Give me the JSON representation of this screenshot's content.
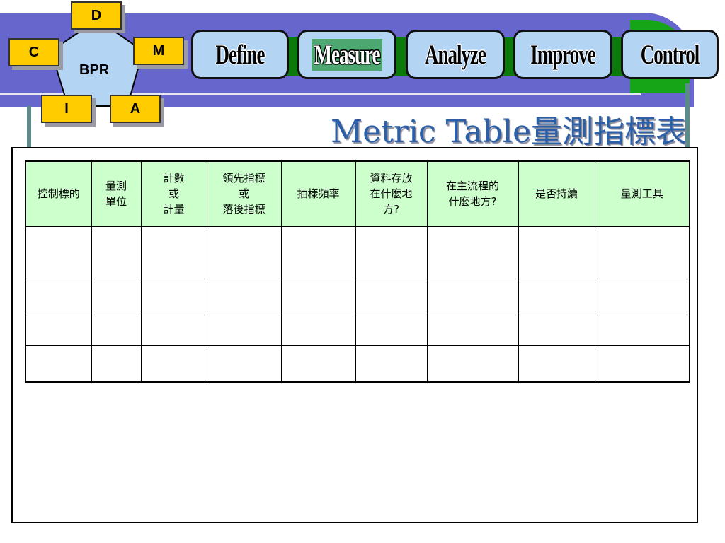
{
  "bpr": {
    "center_label": "BPR",
    "nodes": [
      "D",
      "M",
      "A",
      "I",
      "C"
    ]
  },
  "phases": [
    {
      "label": "Define",
      "active": false
    },
    {
      "label": "Measure",
      "active": true
    },
    {
      "label": "Analyze",
      "active": false
    },
    {
      "label": "Improve",
      "active": false
    },
    {
      "label": "Control",
      "active": false
    }
  ],
  "title": "Metric Table量測指標表",
  "table": {
    "headers": [
      "控制標的",
      "量測\n單位",
      "計數\n或\n計量",
      "領先指標\n或\n落後指標",
      "抽樣頻率",
      "資料存放\n在什麼地\n方?",
      "在主流程的\n什麼地方?",
      "是否持續",
      "量測工具"
    ],
    "rows": [
      [
        "",
        "",
        "",
        "",
        "",
        "",
        "",
        "",
        ""
      ],
      [
        "",
        "",
        "",
        "",
        "",
        "",
        "",
        "",
        ""
      ],
      [
        "",
        "",
        "",
        "",
        "",
        "",
        "",
        "",
        ""
      ],
      [
        "",
        "",
        "",
        "",
        "",
        "",
        "",
        "",
        ""
      ]
    ]
  },
  "colors": {
    "band": "#6666cc",
    "accent_green": "#16a516",
    "phase_fill": "#b4d4f4",
    "bpr_box": "#ffcc00",
    "header_fill": "#ccffcc",
    "title_color": "#2b5fa8"
  }
}
